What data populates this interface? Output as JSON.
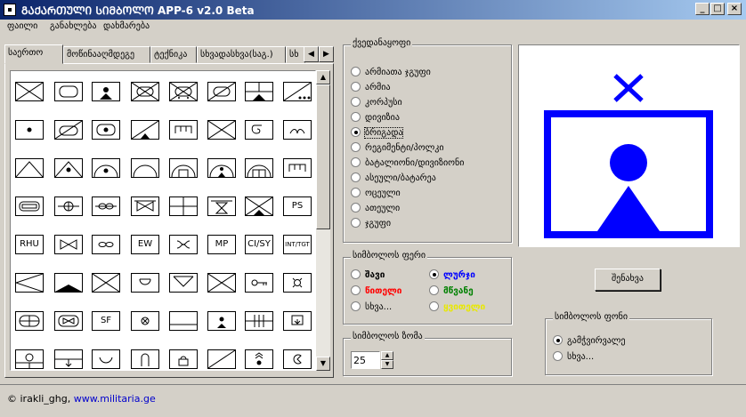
{
  "window": {
    "title": "ᲒᲐᲥᲐᲠᲗᲣᲚᲘ ᲡᲘᲛᲑᲝᲚᲝ APP-6  v2.0 Beta"
  },
  "menu": [
    "ფაილი",
    "განახლება",
    "დახმარება"
  ],
  "tabs": [
    "საერთო",
    "მოწინააღმდეგე",
    "ტექნიკა",
    "სხვადასხვა(საგ.)",
    "სხ"
  ],
  "symbol_labels": {
    "ps": "PS",
    "rhu": "RHU",
    "ew": "EW",
    "mp": "MP",
    "cisy": "CI/SY",
    "intel": "INT/TGT",
    "sf": "SF"
  },
  "unit_size": {
    "legend": "ქვედანაყოფი",
    "options": [
      "არმიათა ჯგუფი",
      "არმია",
      "კორპუსი",
      "დივიზია",
      "ბრიგადა",
      "რეგიმენტი/პოლკი",
      "ბატალიონი/დივიზიონი",
      "ასეული/ბატარეა",
      "ოცეული",
      "ათეული",
      "ჯგუფი"
    ],
    "selected": "ბრიგადა"
  },
  "symbol_color": {
    "legend": "სიმბოლოს ფერი",
    "options": [
      {
        "label": "შავი",
        "color": "#000000"
      },
      {
        "label": "ლურჯი",
        "color": "#0000ff"
      },
      {
        "label": "წითელი",
        "color": "#ff0000"
      },
      {
        "label": "მწვანე",
        "color": "#008000"
      },
      {
        "label": "სხვა...",
        "color": "#000000"
      },
      {
        "label": "ყვითელი",
        "color": "#e8e800"
      }
    ],
    "selected": "ლურჯი"
  },
  "symbol_size": {
    "legend": "სიმბოლოს ზომა",
    "value": "25"
  },
  "save_button": "შენახვა",
  "symbol_background": {
    "legend": "სიმბოლოს ფონი",
    "options": [
      "გამჭვირვალე",
      "სხვა..."
    ],
    "selected": "გამჭვირვალე"
  },
  "preview": {
    "color": "#0000ff"
  },
  "status": {
    "author": "irakli_ghg,",
    "link": "www.militaria.ge",
    "copyright": "©"
  },
  "title_buttons": {
    "minimize": "_",
    "maximize": "□",
    "close": "×"
  }
}
